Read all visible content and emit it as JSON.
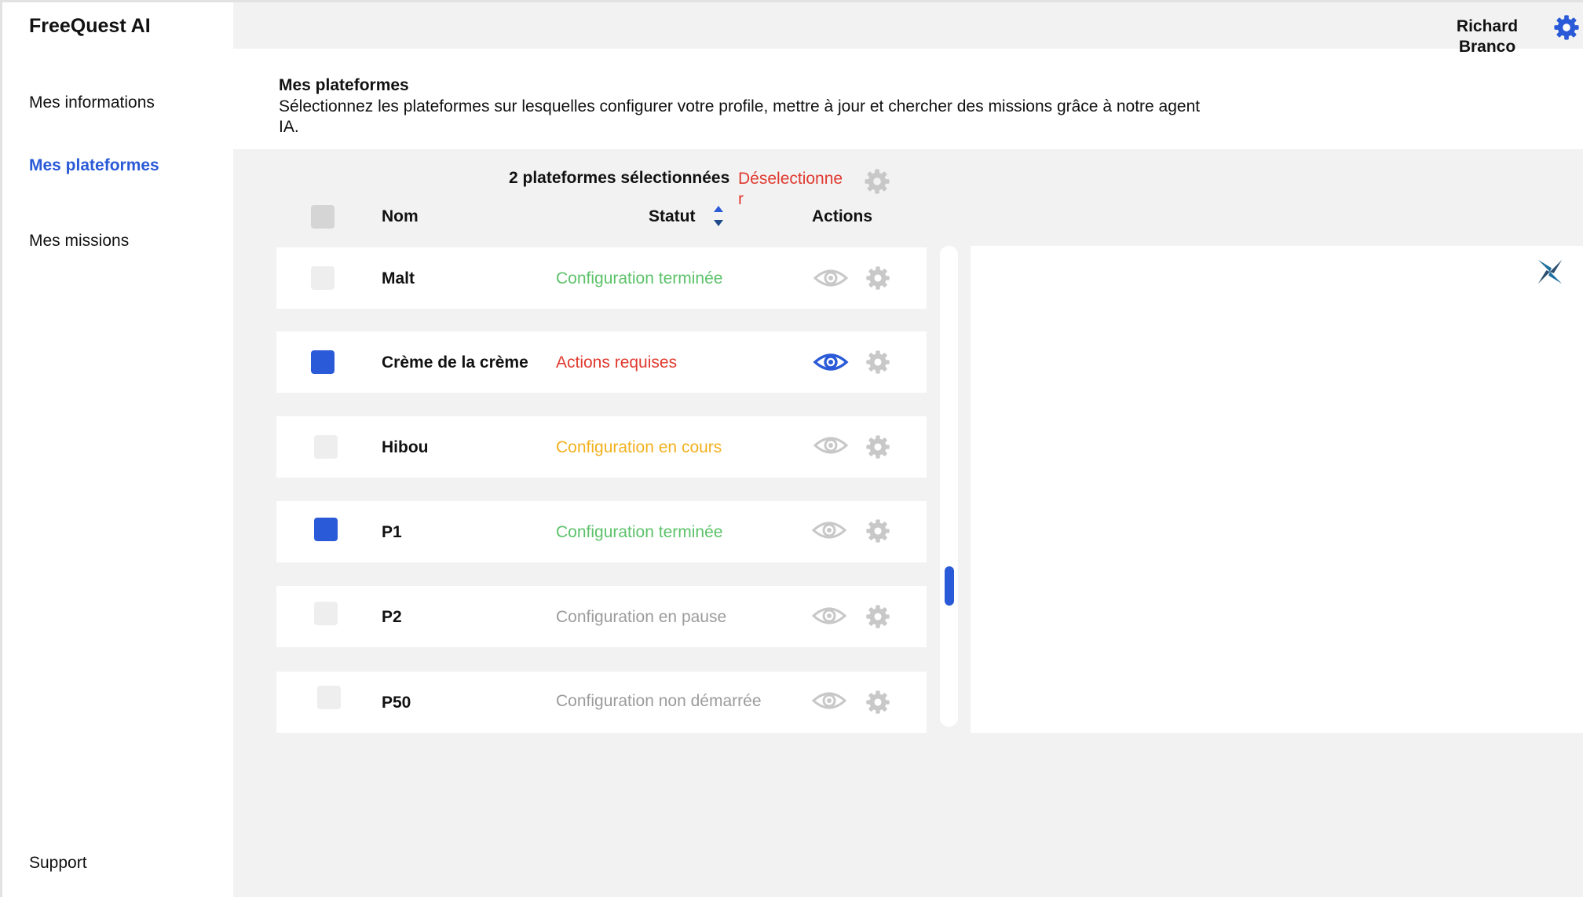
{
  "app": {
    "name": "FreeQuest AI"
  },
  "nav": {
    "items": [
      {
        "label": "Mes informations",
        "active": false
      },
      {
        "label": "Mes plateformes",
        "active": true
      },
      {
        "label": "Mes missions",
        "active": false
      }
    ],
    "support_label": "Support"
  },
  "user": {
    "first_name": "Richard",
    "last_name": "Branco",
    "settings_icon": "gear-icon"
  },
  "page": {
    "title": "Mes plateformes",
    "description": "Sélectionnez les plateformes sur lesquelles configurer votre profile, mettre à jour et chercher des missions grâce à notre agent IA."
  },
  "selection": {
    "count_label": "2 plateformes sélectionnées",
    "deselect_label": "Déselectionner"
  },
  "table": {
    "headers": {
      "name": "Nom",
      "status": "Statut",
      "actions": "Actions"
    },
    "rows": [
      {
        "name": "Malt",
        "status": "Configuration terminée",
        "status_color": "#5cc26a",
        "checked": false,
        "view_active": false
      },
      {
        "name": "Crème de la crème",
        "status": "Actions requises",
        "status_color": "#e03a2f",
        "checked": true,
        "view_active": true
      },
      {
        "name": "Hibou",
        "status": "Configuration en cours",
        "status_color": "#f2b01e",
        "checked": false,
        "view_active": false
      },
      {
        "name": "P1",
        "status": "Configuration terminée",
        "status_color": "#5cc26a",
        "checked": true,
        "view_active": false
      },
      {
        "name": "P2",
        "status": "Configuration en pause",
        "status_color": "#9b9b9b",
        "checked": false,
        "view_active": false
      },
      {
        "name": "P50",
        "status": "Configuration non démarrée",
        "status_color": "#9b9b9b",
        "checked": false,
        "view_active": false
      }
    ]
  },
  "colors": {
    "accent": "#2a5ad7",
    "danger": "#e03a2f",
    "panel_bg": "#f2f2f2",
    "icon_inactive": "#c8c8c8"
  },
  "icons": {
    "row_view": "eye-icon",
    "row_settings": "gear-icon",
    "sort": "sort-icon",
    "panel": "star-icon"
  }
}
